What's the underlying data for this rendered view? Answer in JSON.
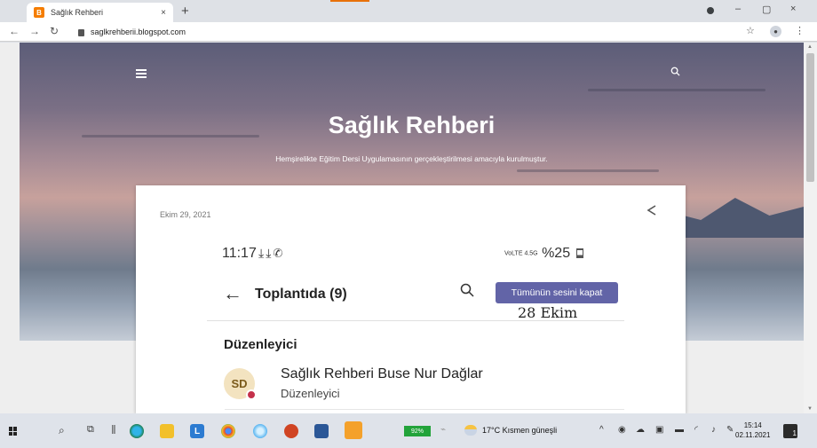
{
  "browser": {
    "tab_title": "Sağlık Rehberi",
    "tab_close": "×",
    "new_tab": "+",
    "url": "saglkrehberii.blogspot.com",
    "minimize": "–",
    "restore": "▢",
    "close": "×"
  },
  "page": {
    "blog_title": "Sağlık Rehberi",
    "blog_subtitle": "Hemşirelikte Eğitim Dersi Uygulamasının gerçekleştirilmesi amacıyla kurulmuştur.",
    "post_date": "Ekim 29, 2021"
  },
  "screenshot": {
    "time": "11:17",
    "status_right": "%25",
    "status_net": "VoLTE 4.5G",
    "header_title": "Toplantıda (9)",
    "mute_button": "Tümünün sesini kapat",
    "date_note": "28 Ekim",
    "section": "Düzenleyici",
    "avatar_initials": "SD",
    "person_name": "Sağlık Rehberi Buse Nur Dağlar",
    "person_role": "Düzenleyici"
  },
  "taskbar": {
    "battery": "92%",
    "weather": "17°C  Kısmen güneşli",
    "time": "15:14",
    "date": "02.11.2021",
    "notifications": "1"
  },
  "colors": {
    "teams_purple": "#6264a7",
    "presence_busy": "#c4314b",
    "blogger_orange": "#f57d00"
  }
}
